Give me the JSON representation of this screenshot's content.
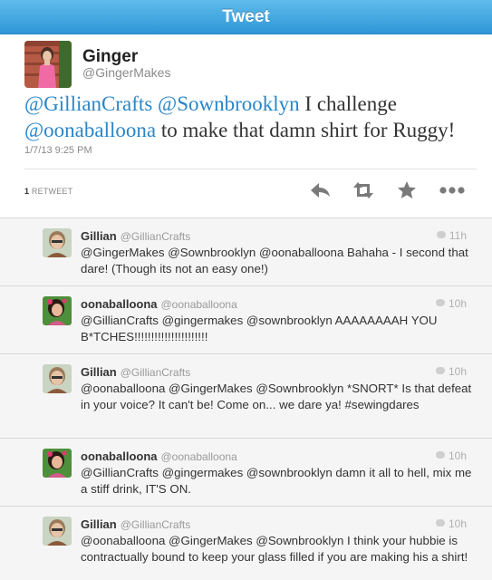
{
  "nav": {
    "title": "Tweet"
  },
  "tweet": {
    "name": "Ginger",
    "handle": "@GingerMakes",
    "text": {
      "m1": "@GillianCrafts",
      "m2": "@Sownbrooklyn",
      "t1": "I challenge",
      "m3": "@oonaballoona",
      "t2": "to make that damn shirt for Ruggy!"
    },
    "timestamp": "1/7/13 9:25 PM",
    "retweet_count": "1",
    "retweet_label": "RETWEET"
  },
  "replies": [
    {
      "name": "Gillian",
      "handle": "@GillianCrafts",
      "time": "11h",
      "text": "@GingerMakes @Sownbrooklyn @oonaballoona Bahaha - I second that dare! (Though its not an easy one!)"
    },
    {
      "name": "oonaballoona",
      "handle": "@oonaballoona",
      "time": "10h",
      "text": "@GillianCrafts @gingermakes @sownbrooklyn AAAAAAAAH YOU B*TCHES!!!!!!!!!!!!!!!!!!!!!!"
    },
    {
      "name": "Gillian",
      "handle": "@GillianCrafts",
      "time": "10h",
      "text": "@oonaballoona @GingerMakes @Sownbrooklyn *SNORT* Is that defeat in your voice? It can't be! Come on... we dare ya! #sewingdares"
    },
    {
      "name": "oonaballoona",
      "handle": "@oonaballoona",
      "time": "10h",
      "text": "@GillianCrafts @gingermakes @sownbrooklyn damn it all to hell, mix me a stiff drink, IT'S ON."
    },
    {
      "name": "Gillian",
      "handle": "@GillianCrafts",
      "time": "10h",
      "text": "@oonaballoona @GingerMakes @Sownbrooklyn I think your hubbie is contractually bound to keep your glass filled if you are making his a shirt!"
    }
  ],
  "icons": {
    "reply": "reply-icon",
    "retweet": "retweet-icon",
    "favorite": "star-icon",
    "more": "more-icon"
  },
  "colors": {
    "nav_top": "#5fbcec",
    "nav_bottom": "#2f96d6",
    "mention": "#2a86c8"
  }
}
